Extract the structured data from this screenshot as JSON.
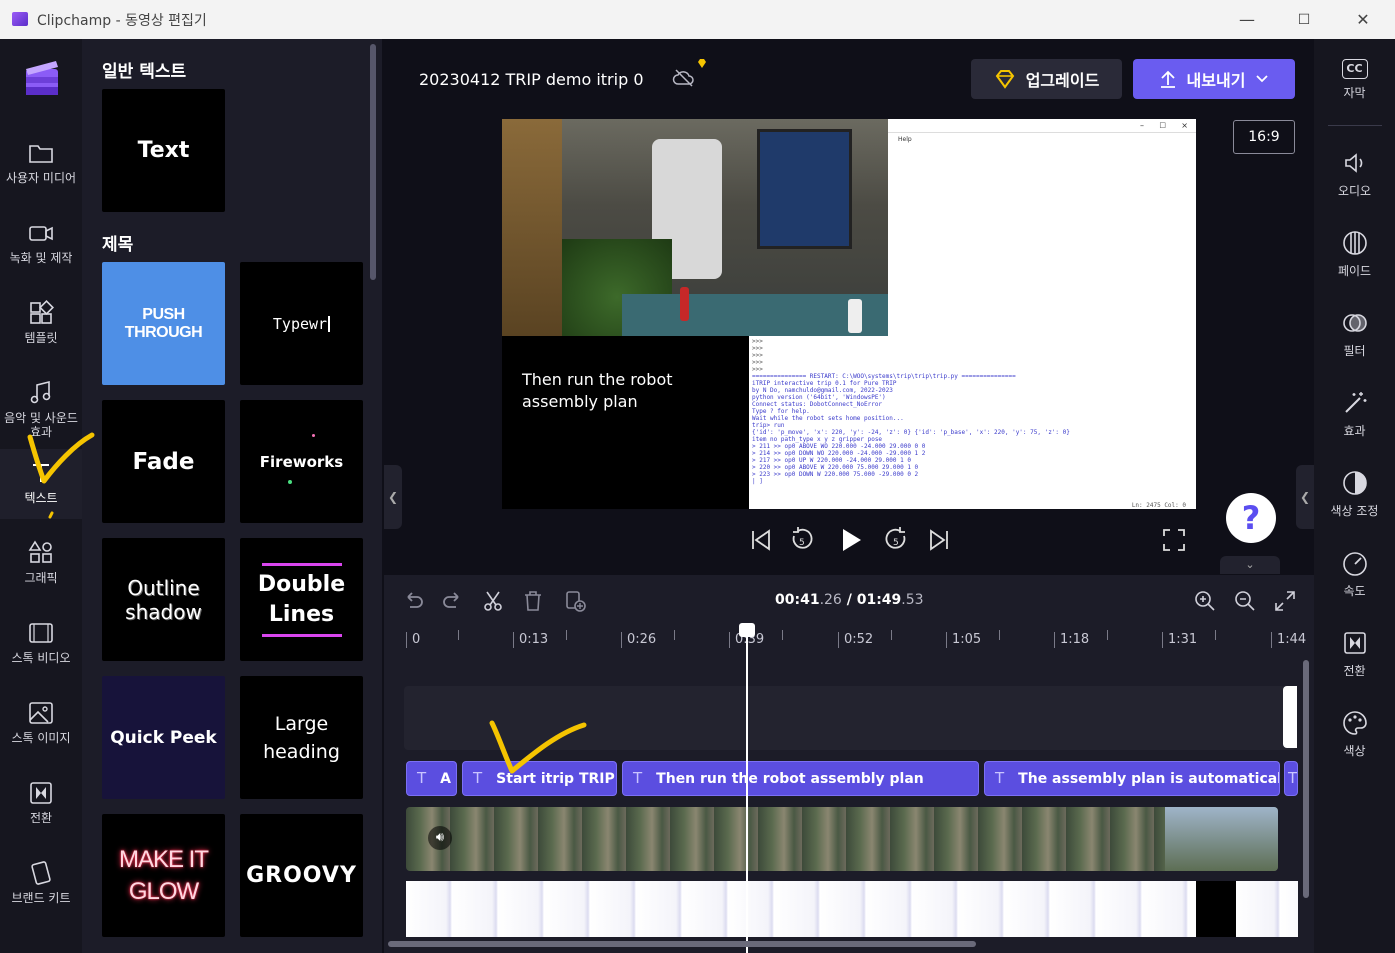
{
  "window": {
    "title": "Clipchamp - 동영상 편집기",
    "controls": {
      "minimize": "—",
      "maximize": "☐",
      "close": "✕"
    }
  },
  "leftnav": {
    "items": [
      {
        "label": "사용자 미디어",
        "icon": "folder-icon"
      },
      {
        "label": "녹화 및 제작",
        "icon": "camera-icon"
      },
      {
        "label": "템플릿",
        "icon": "template-icon"
      },
      {
        "label": "음악 및 사운드 효과",
        "icon": "music-icon"
      },
      {
        "label": "텍스트",
        "icon": "text-icon",
        "active": true
      },
      {
        "label": "그래픽",
        "icon": "shapes-icon"
      },
      {
        "label": "스톡 비디오",
        "icon": "film-icon"
      },
      {
        "label": "스톡 이미지",
        "icon": "image-icon"
      },
      {
        "label": "전환",
        "icon": "transition-icon"
      },
      {
        "label": "브랜드 키트",
        "icon": "brand-kit-icon"
      }
    ]
  },
  "panel": {
    "section_general": "일반 텍스트",
    "section_titles": "제목",
    "cards": {
      "text": "Text",
      "push": "PUSH THROUGH",
      "typewriter": "Typewr",
      "fade": "Fade",
      "fireworks": "Fireworks",
      "outline1": "Outline",
      "outline2": "shadow",
      "double1": "Double",
      "double2": "Lines",
      "quickpeek": "Quick Peek",
      "large1": "Large",
      "large2": "heading",
      "glow1": "MAKE IT",
      "glow2": "GLOW",
      "groovy": "GROOVY"
    }
  },
  "header": {
    "project_title": "20230412 TRIP demo itrip 0",
    "upgrade_label": "업그레이드",
    "export_label": "내보내기",
    "aspect_ratio": "16:9"
  },
  "preview": {
    "caption": "Then run the robot assembly plan",
    "screen_menu": "Help",
    "console_lines": [
      ">>>",
      ">>>",
      ">>>",
      ">>>",
      ">>>",
      "=============== RESTART: C:\\WOO\\systems\\trip\\trip\\trip.py ===============",
      "iTRIP interactive trip 0.1 for Pure TRIP",
      "by N Do, namchuldo@gmail.com, 2022-2023",
      "python version ('64bit', 'WindowsPE')",
      "Connect status: DobotConnect_NoError",
      "Type ? for help.",
      "Wait while the robot sets home position...",
      "trip> run",
      "{'id': 'p_move', 'x': 220, 'y': -24, 'z': 0} {'id': 'p_base', 'x': 220, 'y': 75, 'z': 0}",
      "item no    path_type  x      y      z      gripper   pose",
      "> 211 >> op0      ABOVE WO       220.000   -24.000    29.000      0       0",
      "> 214 >> op0      DOWN WO        220.000   -24.000   -29.000      1       2",
      "> 217 >> op0      UP W           220.000   -24.000    29.000      1       0",
      "> 220 >> op0      ABOVE W        220.000    75.000    29.000      1       0",
      "> 223 >> op0      DOWN W         220.000    75.000   -29.000      0       2",
      "| ]"
    ],
    "status_line": "Ln: 2475   Col: 0"
  },
  "timeline": {
    "time_current_main": "00:41",
    "time_current_frac": ".26",
    "separator": "/",
    "time_total_main": "01:49",
    "time_total_frac": ".53",
    "ruler_labels": [
      "0",
      "0:13",
      "0:26",
      "0:39",
      "0:52",
      "1:05",
      "1:18",
      "1:31",
      "1:44"
    ],
    "text_clips": [
      {
        "label": "A"
      },
      {
        "label": "Start itrip TRIP is"
      },
      {
        "label": "Then run the robot assembly plan"
      },
      {
        "label": "The assembly plan is automatically pr"
      }
    ],
    "text_clip_icon": "T"
  },
  "rightnav": {
    "items": [
      {
        "label": "자막",
        "icon": "cc-icon"
      },
      {
        "label": "오디오",
        "icon": "speaker-icon"
      },
      {
        "label": "페이드",
        "icon": "fade-icon"
      },
      {
        "label": "필터",
        "icon": "filter-icon"
      },
      {
        "label": "효과",
        "icon": "magic-wand-icon"
      },
      {
        "label": "색상 조정",
        "icon": "contrast-icon"
      },
      {
        "label": "속도",
        "icon": "speedometer-icon"
      },
      {
        "label": "전환",
        "icon": "transition-icon"
      },
      {
        "label": "색상",
        "icon": "palette-icon"
      }
    ],
    "cc_glyph": "CC"
  },
  "help_glyph": "?",
  "colors": {
    "accent": "#6a5cf0",
    "clip": "#5b4ee0",
    "annotation": "#f5c400"
  }
}
